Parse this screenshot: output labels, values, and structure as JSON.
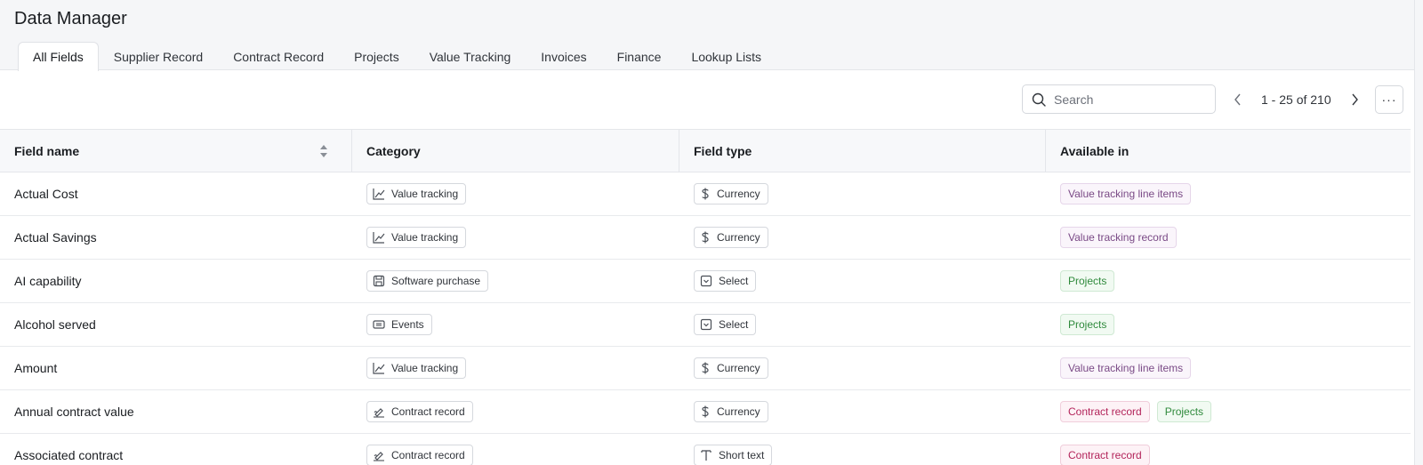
{
  "app": {
    "title": "Data Manager"
  },
  "tabs": [
    {
      "label": "All Fields",
      "active": true
    },
    {
      "label": "Supplier Record"
    },
    {
      "label": "Contract Record"
    },
    {
      "label": "Projects"
    },
    {
      "label": "Value Tracking"
    },
    {
      "label": "Invoices"
    },
    {
      "label": "Finance"
    },
    {
      "label": "Lookup Lists"
    }
  ],
  "toolbar": {
    "search_placeholder": "Search",
    "pagination": "1 - 25 of 210",
    "more_label": "···"
  },
  "table": {
    "columns": [
      "Field name",
      "Category",
      "Field type",
      "Available in"
    ],
    "rows": [
      {
        "name": "Actual Cost",
        "category": "Value tracking",
        "category_icon": "chart-icon",
        "type": "Currency",
        "type_icon": "dollar-icon",
        "available": [
          {
            "label": "Value tracking line items",
            "color": "purple"
          }
        ]
      },
      {
        "name": "Actual Savings",
        "category": "Value tracking",
        "category_icon": "chart-icon",
        "type": "Currency",
        "type_icon": "dollar-icon",
        "available": [
          {
            "label": "Value tracking record",
            "color": "purple"
          }
        ]
      },
      {
        "name": "AI capability",
        "category": "Software purchase",
        "category_icon": "floppy-icon",
        "type": "Select",
        "type_icon": "select-icon",
        "available": [
          {
            "label": "Projects",
            "color": "green"
          }
        ]
      },
      {
        "name": "Alcohol served",
        "category": "Events",
        "category_icon": "ticket-icon",
        "type": "Select",
        "type_icon": "select-icon",
        "available": [
          {
            "label": "Projects",
            "color": "green"
          }
        ]
      },
      {
        "name": "Amount",
        "category": "Value tracking",
        "category_icon": "chart-icon",
        "type": "Currency",
        "type_icon": "dollar-icon",
        "available": [
          {
            "label": "Value tracking line items",
            "color": "purple"
          }
        ]
      },
      {
        "name": "Annual contract value",
        "category": "Contract record",
        "category_icon": "signature-icon",
        "type": "Currency",
        "type_icon": "dollar-icon",
        "available": [
          {
            "label": "Contract record",
            "color": "pink"
          },
          {
            "label": "Projects",
            "color": "green"
          }
        ]
      },
      {
        "name": "Associated contract",
        "category": "Contract record",
        "category_icon": "signature-icon",
        "type": "Short text",
        "type_icon": "text-icon",
        "available": [
          {
            "label": "Contract record",
            "color": "pink"
          }
        ]
      }
    ]
  },
  "colors": {
    "purple": "#7a4a86",
    "green": "#2f8a3c",
    "pink": "#b3245a",
    "header_bg": "#f5f6f8"
  }
}
